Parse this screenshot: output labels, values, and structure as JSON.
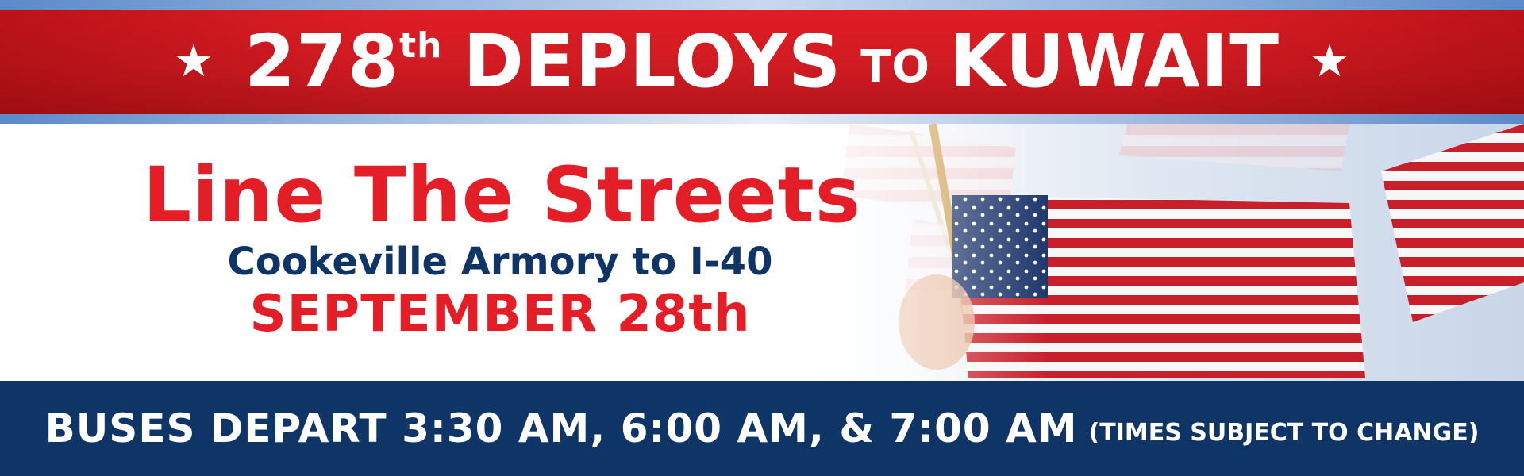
{
  "header": {
    "star_left": "★",
    "number": "278",
    "suffix": "th",
    "word_deploys": "DEPLOYS",
    "word_to": "TO",
    "word_destination": "KUWAIT",
    "star_right": "★"
  },
  "main": {
    "title": "Line The Streets",
    "route": "Cookeville Armory to I-40",
    "date": "SEPTEMBER 28th"
  },
  "footer": {
    "departures": "BUSES DEPART 3:30 AM, 6:00 AM, & 7:00 AM",
    "note": "(TIMES SUBJECT TO CHANGE)"
  },
  "colors": {
    "red": "#e31e26",
    "navy": "#0f3567",
    "white": "#ffffff"
  }
}
